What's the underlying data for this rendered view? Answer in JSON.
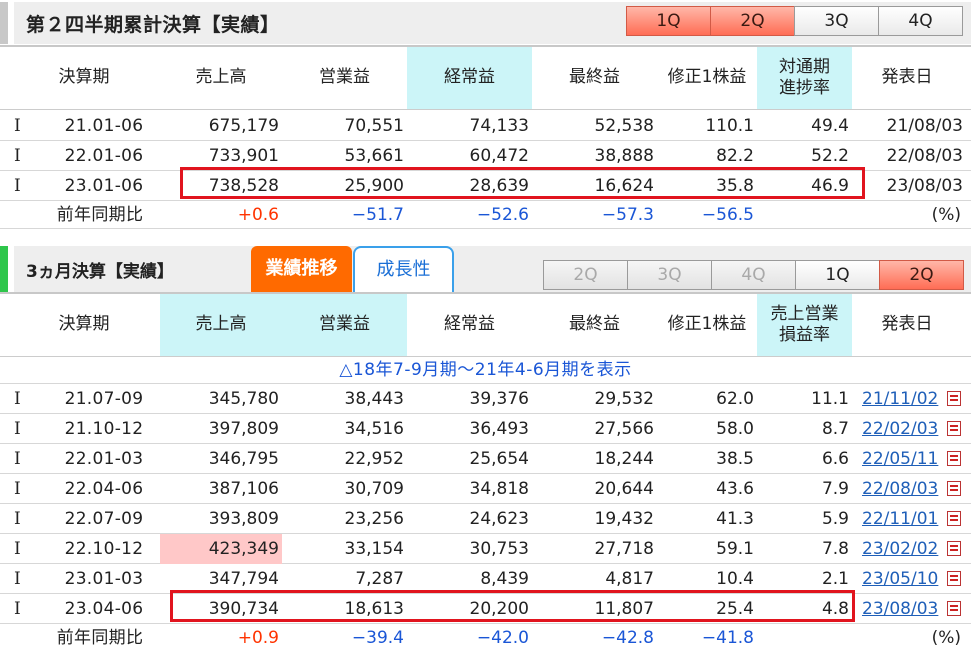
{
  "cumulative": {
    "title": "第２四半期累計決算【実績】",
    "quarter_tabs": [
      {
        "label": "1Q",
        "state": "on"
      },
      {
        "label": "2Q",
        "state": "on"
      },
      {
        "label": "3Q",
        "state": "off"
      },
      {
        "label": "4Q",
        "state": "off"
      }
    ],
    "headers": {
      "period": "決算期",
      "sales": "売上高",
      "operating": "営業益",
      "ordinary": "経常益",
      "net": "最終益",
      "eps": "修正1株益",
      "progress_1": "対通期",
      "progress_2": "進捗率",
      "announce": "発表日"
    },
    "rows": [
      {
        "mark": "I",
        "period": "21.01-06",
        "sales": "675,179",
        "operating": "70,551",
        "ordinary": "74,133",
        "net": "52,538",
        "eps": "110.1",
        "ratio": "49.4",
        "date": "21/08/03"
      },
      {
        "mark": "I",
        "period": "22.01-06",
        "sales": "733,901",
        "operating": "53,661",
        "ordinary": "60,472",
        "net": "38,888",
        "eps": "82.2",
        "ratio": "52.2",
        "date": "22/08/03"
      },
      {
        "mark": "I",
        "period": "23.01-06",
        "sales": "738,528",
        "operating": "25,900",
        "ordinary": "28,639",
        "net": "16,624",
        "eps": "35.8",
        "ratio": "46.9",
        "date": "23/08/03"
      }
    ],
    "yoy": {
      "label": "前年同期比",
      "sales": "+0.6",
      "operating": "−51.7",
      "ordinary": "−52.6",
      "net": "−57.3",
      "eps": "−56.5",
      "unit": "(%)"
    }
  },
  "quarterly": {
    "title": "3ヵ月決算【実績】",
    "tab_active": "業績推移",
    "tab_inactive": "成長性",
    "quarter_tabs": [
      {
        "label": "2Q",
        "state": "dim"
      },
      {
        "label": "3Q",
        "state": "dim"
      },
      {
        "label": "4Q",
        "state": "dim"
      },
      {
        "label": "1Q",
        "state": "off"
      },
      {
        "label": "2Q",
        "state": "on"
      }
    ],
    "headers": {
      "period": "決算期",
      "sales": "売上高",
      "operating": "営業益",
      "ordinary": "経常益",
      "net": "最終益",
      "eps": "修正1株益",
      "margin_1": "売上営業",
      "margin_2": "損益率",
      "announce": "発表日"
    },
    "show_more": "△18年7-9月期～21年4-6月期を表示",
    "rows": [
      {
        "mark": "I",
        "period": "21.07-09",
        "sales": "345,780",
        "operating": "38,443",
        "ordinary": "39,376",
        "net": "29,532",
        "eps": "62.0",
        "ratio": "11.1",
        "date": "21/11/02"
      },
      {
        "mark": "I",
        "period": "21.10-12",
        "sales": "397,809",
        "operating": "34,516",
        "ordinary": "36,493",
        "net": "27,566",
        "eps": "58.0",
        "ratio": "8.7",
        "date": "22/02/03"
      },
      {
        "mark": "I",
        "period": "22.01-03",
        "sales": "346,795",
        "operating": "22,952",
        "ordinary": "25,654",
        "net": "18,244",
        "eps": "38.5",
        "ratio": "6.6",
        "date": "22/05/11"
      },
      {
        "mark": "I",
        "period": "22.04-06",
        "sales": "387,106",
        "operating": "30,709",
        "ordinary": "34,818",
        "net": "20,644",
        "eps": "43.6",
        "ratio": "7.9",
        "date": "22/08/03"
      },
      {
        "mark": "I",
        "period": "22.07-09",
        "sales": "393,809",
        "operating": "23,256",
        "ordinary": "24,623",
        "net": "19,432",
        "eps": "41.3",
        "ratio": "5.9",
        "date": "22/11/01"
      },
      {
        "mark": "I",
        "period": "22.10-12",
        "sales": "423,349",
        "operating": "33,154",
        "ordinary": "30,753",
        "net": "27,718",
        "eps": "59.1",
        "ratio": "7.8",
        "date": "23/02/02"
      },
      {
        "mark": "I",
        "period": "23.01-03",
        "sales": "347,794",
        "operating": "7,287",
        "ordinary": "8,439",
        "net": "4,817",
        "eps": "10.4",
        "ratio": "2.1",
        "date": "23/05/10"
      },
      {
        "mark": "I",
        "period": "23.04-06",
        "sales": "390,734",
        "operating": "18,613",
        "ordinary": "20,200",
        "net": "11,807",
        "eps": "25.4",
        "ratio": "4.8",
        "date": "23/08/03"
      }
    ],
    "yoy": {
      "label": "前年同期比",
      "sales": "+0.9",
      "operating": "−39.4",
      "ordinary": "−42.0",
      "net": "−42.8",
      "eps": "−41.8",
      "unit": "(%)"
    },
    "icons": {
      "document": "pdf-icon"
    }
  },
  "colors": {
    "highlight_column": "#ccf5f8",
    "highlight_box": "#e1141e",
    "positive": "#ff3300",
    "negative": "#1a56d6",
    "max_cell": "#ffc8c8"
  }
}
